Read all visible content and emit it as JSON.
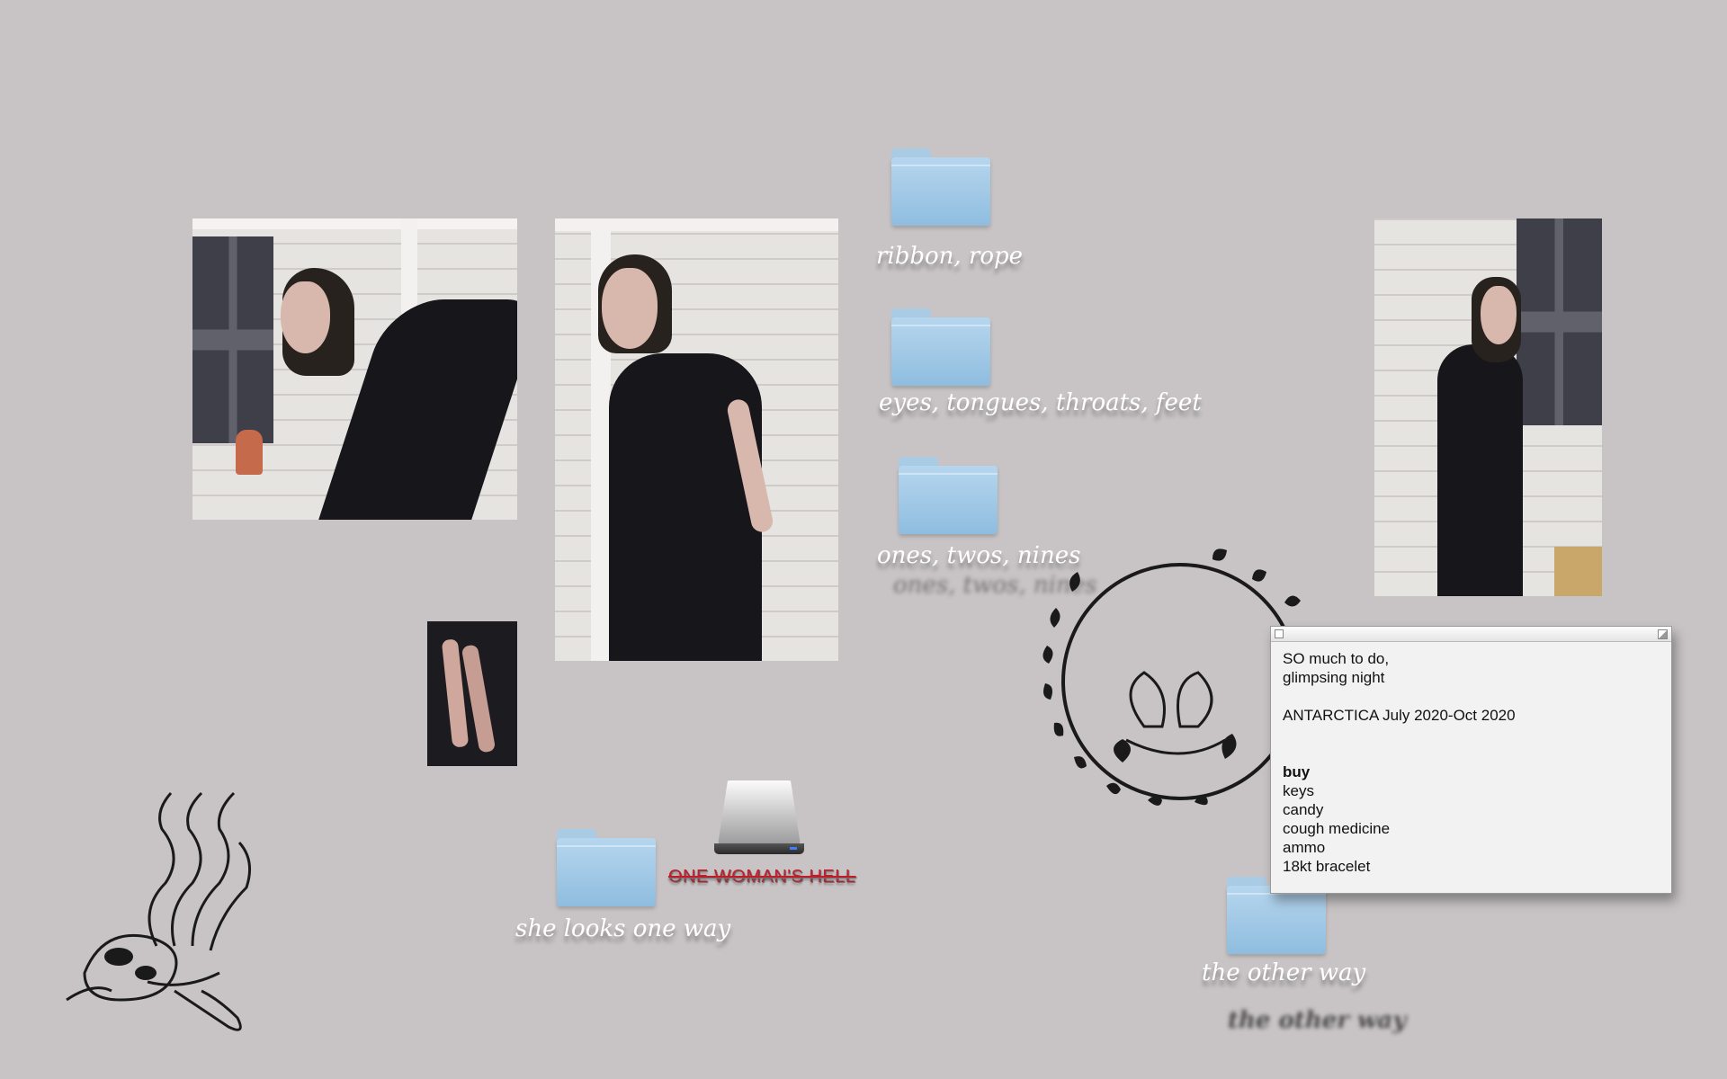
{
  "photos": [
    {
      "name": "photo-woman-leaning"
    },
    {
      "name": "photo-woman-hand-on-hip"
    },
    {
      "name": "photo-hands-detail"
    },
    {
      "name": "photo-woman-profile-window"
    }
  ],
  "folders": {
    "ribbon": {
      "label": "ribbon, rope"
    },
    "eyes": {
      "label": "eyes, tongues, throats, feet"
    },
    "ones": {
      "label": "ones, twos, nines",
      "ghost": "ones, twos, nines"
    },
    "she": {
      "label": "she looks one way"
    },
    "other": {
      "label": "the other way",
      "ghost": "the other way"
    }
  },
  "drive": {
    "label": "ONE WOMAN'S HELL",
    "accent": "#c11c2a"
  },
  "note": {
    "lines": [
      "SO much to do,",
      "glimpsing night",
      "",
      "ANTARCTICA July 2020-Oct 2020",
      "",
      "",
      "buy",
      "keys",
      "candy",
      "cough medicine",
      "ammo",
      "18kt bracelet"
    ]
  },
  "colors": {
    "desktop": "#c8c4c6",
    "folder": "#8fbddf"
  },
  "icons": [
    "folder-icon",
    "drive-icon",
    "wreath-drawing-icon",
    "octopus-drawing-icon"
  ]
}
